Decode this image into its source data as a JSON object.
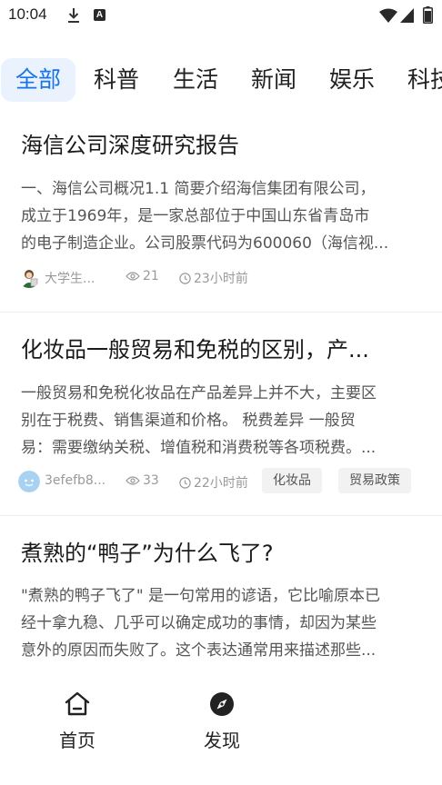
{
  "status_bar": {
    "time": "10:04",
    "icons": [
      "download-icon",
      "app-a-icon",
      "wifi-icon",
      "cellular-icon",
      "battery-icon"
    ]
  },
  "tabs": [
    {
      "label": "全部",
      "active": true
    },
    {
      "label": "科普",
      "active": false
    },
    {
      "label": "生活",
      "active": false
    },
    {
      "label": "新闻",
      "active": false
    },
    {
      "label": "娱乐",
      "active": false
    },
    {
      "label": "科技",
      "active": false
    }
  ],
  "articles": [
    {
      "title": "海信公司深度研究报告",
      "lines": [
        "一、海信公司概况1.1 简要介绍海信集团有限公司，",
        "成立于1969年，是一家总部位于中国山东省青岛市",
        "的电子制造企业。公司股票代码为600060（海信视..."
      ],
      "author": "大学生...",
      "views": "21",
      "time": "23小时前",
      "tags": []
    },
    {
      "title": "化妆品一般贸易和免税的区别，产...",
      "lines": [
        "一般贸易和免税化妆品在产品差异上并不大，主要区",
        "别在于税费、销售渠道和价格。 税费差异 一般贸",
        "易：需要缴纳关税、增值税和消费税等各项税费。..."
      ],
      "author": "3efefb8...",
      "views": "33",
      "time": "22小时前",
      "tags": [
        "化妆品",
        "贸易政策"
      ]
    },
    {
      "title": "煮熟的“鸭子”为什么飞了?",
      "lines": [
        "\"煮熟的鸭子飞了\" 是一句常用的谚语，它比喻原本已",
        "经十拿九稳、几乎可以确定成功的事情，却因为某些",
        "意外的原因而失败了。这个表达通常用来描述那些..."
      ],
      "author": "",
      "views": "",
      "time": "",
      "tags": []
    }
  ],
  "bottom_nav": [
    {
      "label": "首页",
      "icon": "home-icon"
    },
    {
      "label": "发现",
      "icon": "compass-icon"
    }
  ],
  "colors": {
    "accent": "#1a73e8",
    "tab_active_bg": "#e9f2fd"
  }
}
